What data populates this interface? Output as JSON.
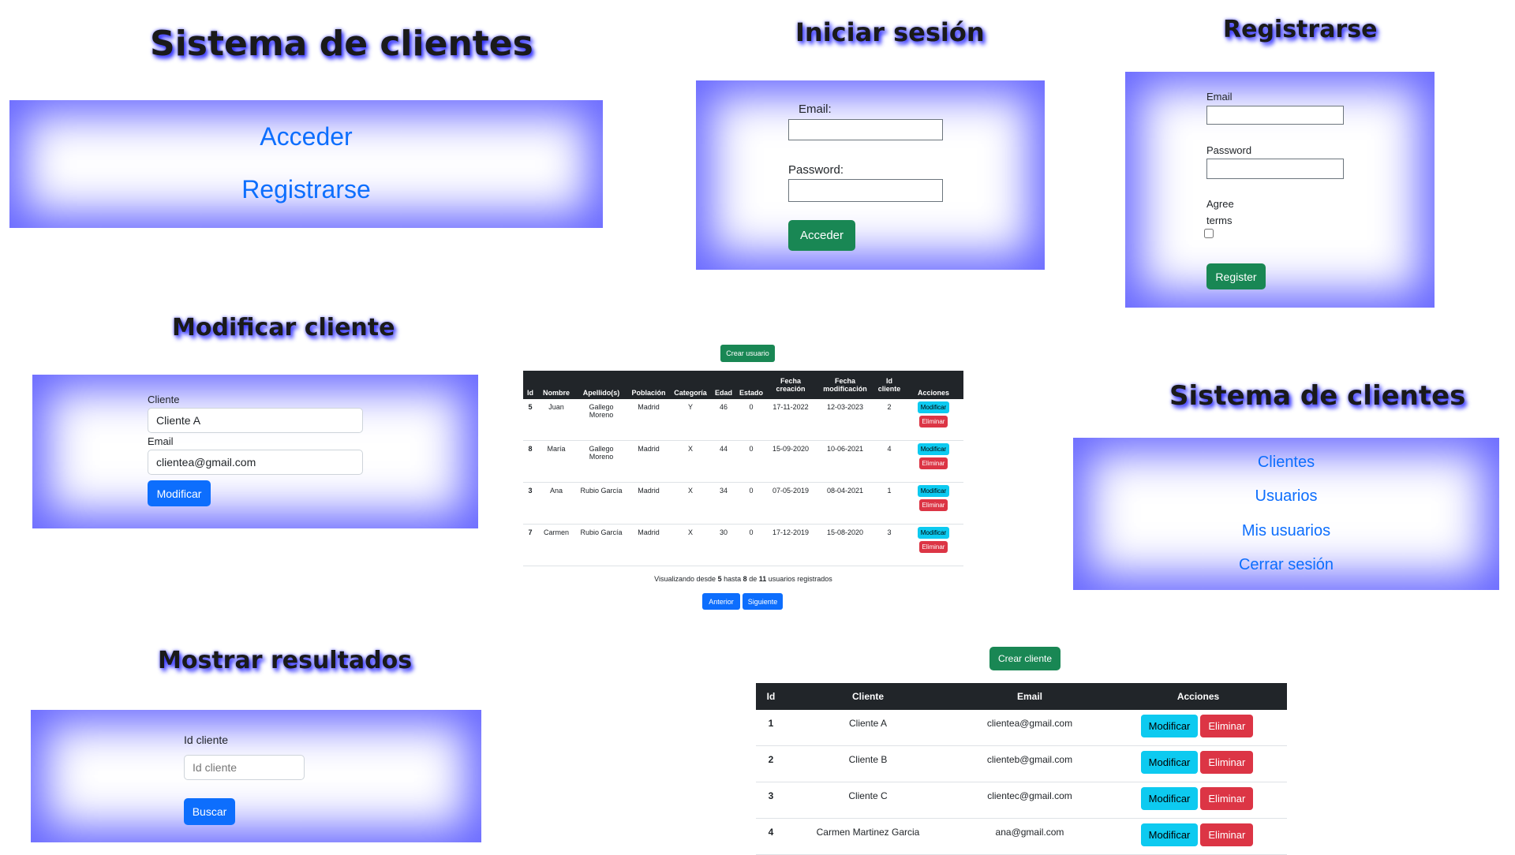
{
  "home": {
    "title": "Sistema de clientes",
    "links": [
      "Acceder",
      "Registrarse"
    ]
  },
  "login": {
    "title": "Iniciar sesión",
    "email_label": "Email:",
    "password_label": "Password:",
    "submit": "Acceder"
  },
  "register": {
    "title": "Registrarse",
    "email_label": "Email",
    "password_label": "Password",
    "agree_line1": "Agree",
    "agree_line2": "terms",
    "submit": "Register"
  },
  "modify": {
    "title": "Modificar cliente",
    "client_label": "Cliente",
    "client_value": "Cliente A",
    "email_label": "Email",
    "email_value": "clientea@gmail.com",
    "submit": "Modificar"
  },
  "users": {
    "create_button": "Crear usuario",
    "headers": [
      "Id",
      "Nombre",
      "Apellido(s)",
      "Población",
      "Categoría",
      "Edad",
      "Estado",
      "Fecha creación",
      "Fecha modificación",
      "Id cliente",
      "Acciones"
    ],
    "rows": [
      [
        "5",
        "Juan",
        "Gallego Moreno",
        "Madrid",
        "Y",
        "46",
        "0",
        "17-11-2022",
        "12-03-2023",
        "2"
      ],
      [
        "8",
        "María",
        "Gallego Moreno",
        "Madrid",
        "X",
        "44",
        "0",
        "15-09-2020",
        "10-06-2021",
        "4"
      ],
      [
        "3",
        "Ana",
        "Rubio García",
        "Madrid",
        "X",
        "34",
        "0",
        "07-05-2019",
        "08-04-2021",
        "1"
      ],
      [
        "7",
        "Carmen",
        "Rubio García",
        "Madrid",
        "X",
        "30",
        "0",
        "17-12-2019",
        "15-08-2020",
        "3"
      ]
    ],
    "modify_label": "Modificar",
    "delete_label": "Eliminar",
    "pagination": {
      "prefix": "Visualizando desde",
      "from": "5",
      "to_word": "hasta",
      "to": "8",
      "of_word": "de",
      "total": "11",
      "suffix": "usuarios registrados"
    },
    "prev": "Anterior",
    "next": "Siguiente"
  },
  "menu": {
    "title": "Sistema de clientes",
    "links": [
      "Clientes",
      "Usuarios",
      "Mis usuarios",
      "Cerrar sesión"
    ]
  },
  "search": {
    "title": "Mostrar resultados",
    "id_label": "Id cliente",
    "id_placeholder": "Id cliente",
    "submit": "Buscar"
  },
  "clients": {
    "create_button": "Crear cliente",
    "headers": [
      "Id",
      "Cliente",
      "Email",
      "Acciones"
    ],
    "rows": [
      [
        "1",
        "Cliente A",
        "clientea@gmail.com"
      ],
      [
        "2",
        "Cliente B",
        "clienteb@gmail.com"
      ],
      [
        "3",
        "Cliente C",
        "clientec@gmail.com"
      ],
      [
        "4",
        "Carmen Martinez Garcia",
        "ana@gmail.com"
      ]
    ],
    "modify_label": "Modificar",
    "delete_label": "Eliminar"
  },
  "colors": {
    "primary": "#0d6efd",
    "success": "#198754",
    "info": "#0dcaf0",
    "danger": "#dc3545",
    "panel_glow": "#6666ff"
  }
}
